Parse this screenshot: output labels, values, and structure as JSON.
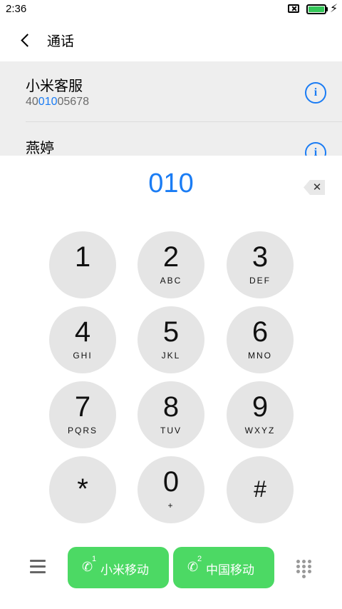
{
  "status_bar": {
    "time": "2:36",
    "charging_icon": "lightning-icon"
  },
  "header": {
    "title": "通话",
    "back_icon": "chevron-left-icon"
  },
  "contacts": [
    {
      "name": "小米客服",
      "number_prefix": "40",
      "number_match": "010",
      "number_suffix": "05678"
    },
    {
      "name": "燕婷"
    }
  ],
  "dialer": {
    "display": "010",
    "backspace_icon": "backspace-icon",
    "keys": [
      {
        "digit": "1",
        "letters": ""
      },
      {
        "digit": "2",
        "letters": "ABC"
      },
      {
        "digit": "3",
        "letters": "DEF"
      },
      {
        "digit": "4",
        "letters": "GHI"
      },
      {
        "digit": "5",
        "letters": "JKL"
      },
      {
        "digit": "6",
        "letters": "MNO"
      },
      {
        "digit": "7",
        "letters": "PQRS"
      },
      {
        "digit": "8",
        "letters": "TUV"
      },
      {
        "digit": "9",
        "letters": "WXYZ"
      },
      {
        "digit": "*",
        "letters": ""
      },
      {
        "digit": "0",
        "letters": "+"
      },
      {
        "digit": "#",
        "letters": ""
      }
    ]
  },
  "bottom": {
    "menu_icon": "menu-icon",
    "sim1": {
      "index": "1",
      "label": "小米移动"
    },
    "sim2": {
      "index": "2",
      "label": "中国移动"
    },
    "keypad_toggle_icon": "keypad-grid-icon"
  },
  "colors": {
    "accent": "#1a7cf4",
    "call_green": "#4cd964",
    "key_bg": "#e5e5e5"
  }
}
